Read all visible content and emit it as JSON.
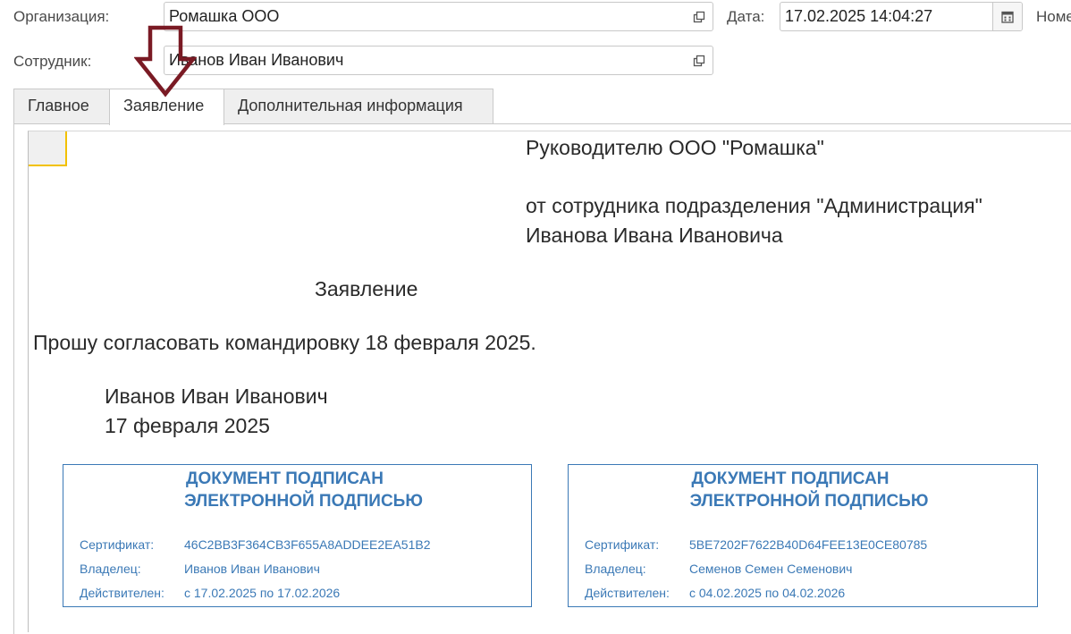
{
  "header": {
    "org_label": "Организация:",
    "org_value": "Ромашка ООО",
    "date_label": "Дата:",
    "date_value": "17.02.2025 14:04:27",
    "number_label": "Номер",
    "employee_label": "Сотрудник:",
    "employee_value": "Иванов Иван Иванович"
  },
  "tabs": [
    {
      "label": "Главное"
    },
    {
      "label": "Заявление"
    },
    {
      "label": "Дополнительная информация"
    }
  ],
  "document": {
    "to": "Руководителю ООО \"Ромашка\"",
    "from_line": "от сотрудника подразделения \"Администрация\"",
    "from_name": "Иванова Ивана Ивановича",
    "title": "Заявление",
    "body": "Прошу согласовать командировку 18 февраля 2025.",
    "sign_name": "Иванов Иван Иванович",
    "sign_date": "17 февраля 2025"
  },
  "stamps": [
    {
      "title_line1": "ДОКУМЕНТ ПОДПИСАН",
      "title_line2": "ЭЛЕКТРОННОЙ ПОДПИСЬЮ",
      "cert_label": "Сертификат:",
      "cert_value": "46C2BB3F364CB3F655A8ADDEE2EA51B2",
      "owner_label": "Владелец:",
      "owner_value": "Иванов Иван Иванович",
      "valid_label": "Действителен:",
      "valid_value": "с 17.02.2025 по 17.02.2026"
    },
    {
      "title_line1": "ДОКУМЕНТ ПОДПИСАН",
      "title_line2": "ЭЛЕКТРОННОЙ ПОДПИСЬЮ",
      "cert_label": "Сертификат:",
      "cert_value": "5BE7202F7622B40D64FEE13E0CE80785",
      "owner_label": "Владелец:",
      "owner_value": "Семенов Семен Семенович",
      "valid_label": "Действителен:",
      "valid_value": "с 04.02.2025 по 04.02.2026"
    }
  ],
  "colors": {
    "stamp_blue": "#3b79b6",
    "arrow": "#7a1a24",
    "corner_accent": "#f2c100"
  },
  "icons": {
    "open": "open-link-icon",
    "calendar": "calendar-icon",
    "annotation": "down-arrow-annotation"
  }
}
